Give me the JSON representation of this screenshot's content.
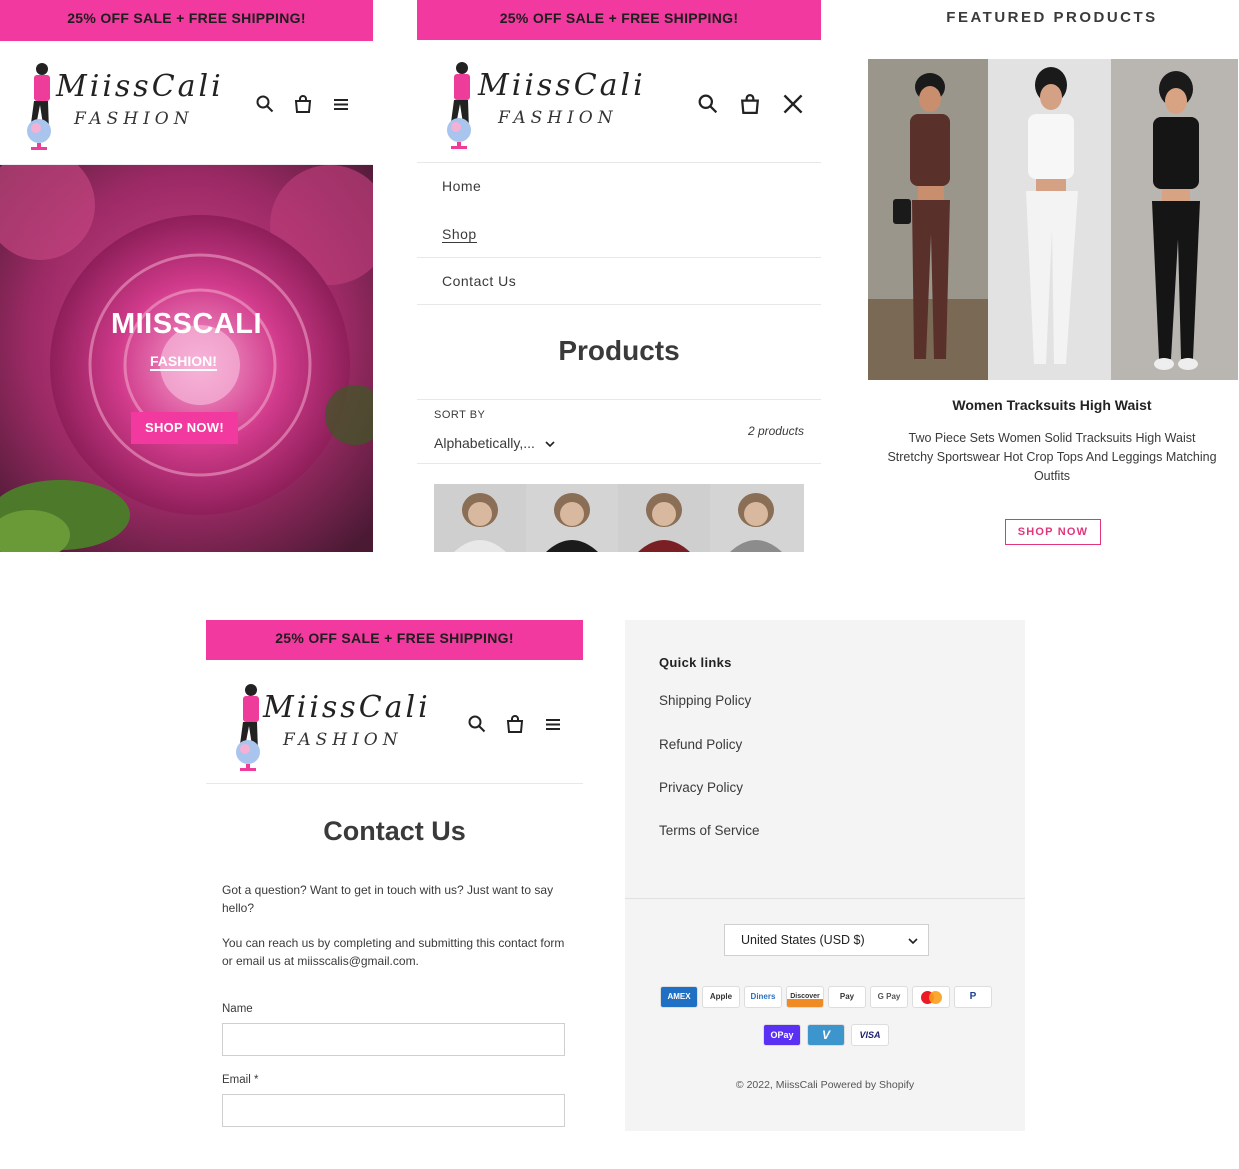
{
  "banner": {
    "text": "25% OFF SALE + FREE SHIPPING!"
  },
  "logo": {
    "line1": "MiissCali",
    "line2": "FASHION"
  },
  "hero": {
    "title": "MIISSCALI",
    "subtitle": "FASHION!",
    "cta": "SHOP NOW!"
  },
  "menu": {
    "items": [
      "Home",
      "Shop",
      "Contact Us"
    ]
  },
  "products_page": {
    "title": "Products",
    "sort_label": "SORT BY",
    "sort_value": "Alphabetically,...",
    "count": "2 products"
  },
  "featured": {
    "heading": "FEATURED PRODUCTS",
    "product_title": "Women Tracksuits High Waist",
    "product_desc": "Two Piece Sets Women Solid Tracksuits High Waist Stretchy Sportswear Hot Crop Tops And Leggings Matching Outfits",
    "cta": "SHOP NOW"
  },
  "contact": {
    "title": "Contact Us",
    "para1": "Got a question? Want to get in touch with us? Just want to say hello?",
    "para2": "You can reach us by completing and submitting this contact form or email us at miisscalis@gmail.com.",
    "name_label": "Name",
    "email_label": "Email *"
  },
  "footer": {
    "quick_links_title": "Quick links",
    "links": [
      "Shipping Policy",
      "Refund Policy",
      "Privacy Policy",
      "Terms of Service"
    ],
    "currency": "United States (USD $)",
    "payments_row1": [
      "AMEX",
      "Apple Pay",
      "Diners",
      "Discover",
      "Pay",
      "G Pay",
      "Mastercard",
      "PayPal"
    ],
    "payments_row2": [
      "OPay",
      "Venmo",
      "VISA"
    ],
    "copyright": "© 2022, MiissCali Powered by Shopify"
  },
  "colors": {
    "accent": "#f2399f",
    "footer_bg": "#f4f4f4",
    "cta_pink": "#e2367c"
  }
}
